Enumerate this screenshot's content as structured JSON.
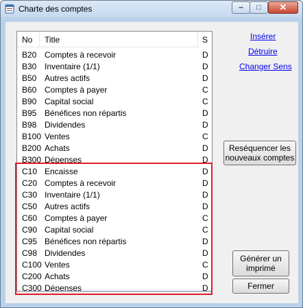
{
  "window": {
    "title": "Charte des comptes"
  },
  "title_buttons": {
    "minimize": "‒",
    "maximize": "□",
    "close": "✕"
  },
  "list": {
    "columns": {
      "no": "No",
      "title": "Title",
      "s": "S"
    },
    "rows": [
      {
        "no": "B20",
        "title": "Comptes à recevoir",
        "s": "D"
      },
      {
        "no": "B30",
        "title": "Inventaire (1/1)",
        "s": "D"
      },
      {
        "no": "B50",
        "title": "Autres actifs",
        "s": "D"
      },
      {
        "no": "B60",
        "title": "Comptes à payer",
        "s": "C"
      },
      {
        "no": "B90",
        "title": "Capital social",
        "s": "C"
      },
      {
        "no": "B95",
        "title": "Bénéfices non répartis",
        "s": "D"
      },
      {
        "no": "B98",
        "title": "Dividendes",
        "s": "D"
      },
      {
        "no": "B100",
        "title": "Ventes",
        "s": "C"
      },
      {
        "no": "B200",
        "title": "Achats",
        "s": "D"
      },
      {
        "no": "B300",
        "title": "Dépenses",
        "s": "D"
      },
      {
        "no": "C10",
        "title": "Encaisse",
        "s": "D"
      },
      {
        "no": "C20",
        "title": "Comptes à recevoir",
        "s": "D"
      },
      {
        "no": "C30",
        "title": "Inventaire (1/1)",
        "s": "D"
      },
      {
        "no": "C50",
        "title": "Autres actifs",
        "s": "D"
      },
      {
        "no": "C60",
        "title": "Comptes à payer",
        "s": "C"
      },
      {
        "no": "C90",
        "title": "Capital social",
        "s": "C"
      },
      {
        "no": "C95",
        "title": "Bénéfices non répartis",
        "s": "D"
      },
      {
        "no": "C98",
        "title": "Dividendes",
        "s": "D"
      },
      {
        "no": "C100",
        "title": "Ventes",
        "s": "C"
      },
      {
        "no": "C200",
        "title": "Achats",
        "s": "D"
      },
      {
        "no": "C300",
        "title": "Dépenses",
        "s": "D"
      }
    ]
  },
  "links": {
    "insert": "Insérer",
    "delete": "Détruire",
    "change_sign": "Changer Sens"
  },
  "buttons": {
    "resequence_line1": "Reséquencer les",
    "resequence_line2": "nouveaux comptes",
    "print_line1": "Générer un",
    "print_line2": "imprimé",
    "close": "Fermer"
  },
  "colors": {
    "highlight": "#e21c2a",
    "link": "#0000ee"
  }
}
